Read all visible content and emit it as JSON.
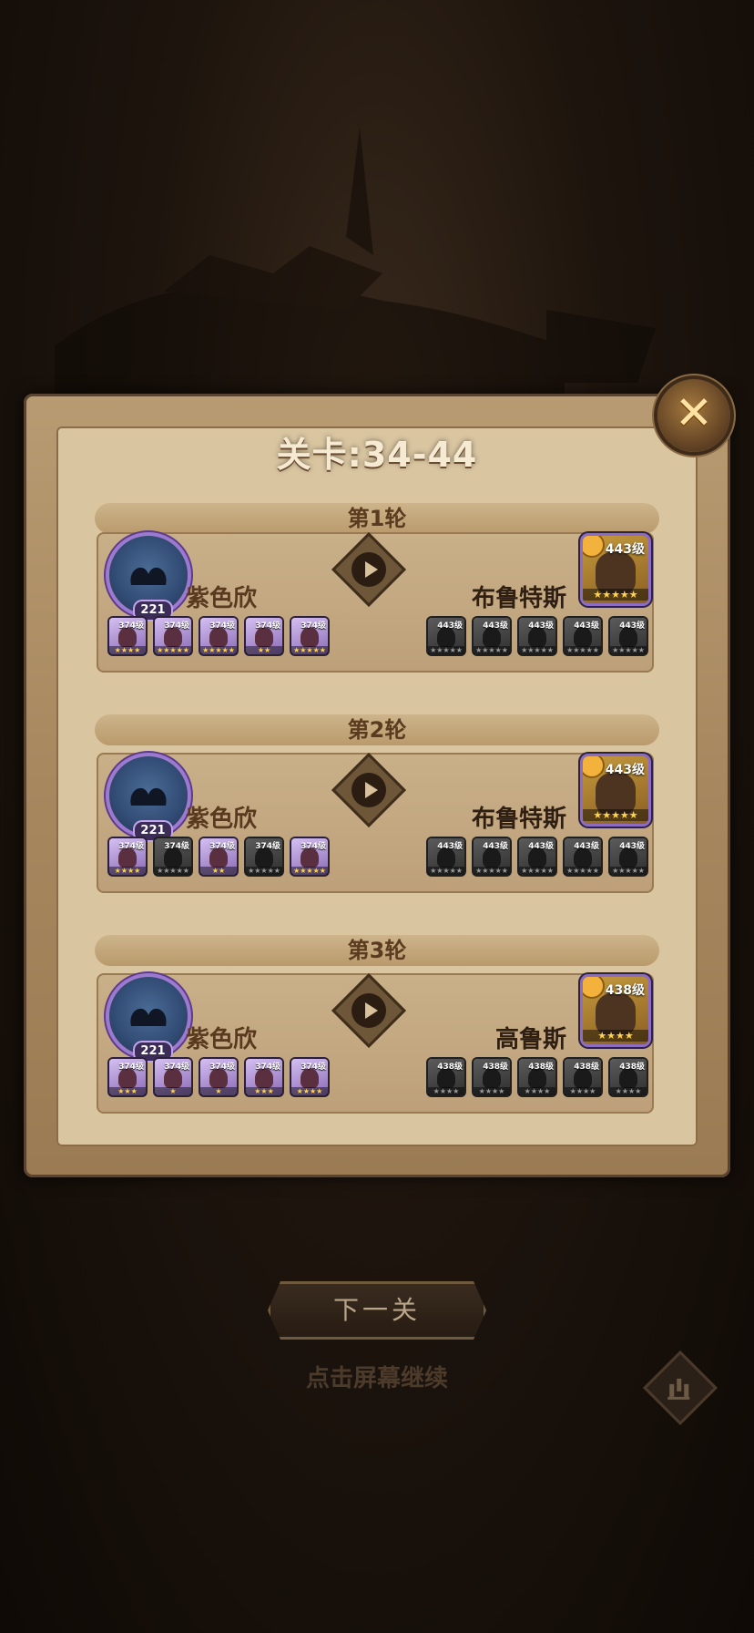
{
  "stage": {
    "title": "关卡:34-44"
  },
  "rounds": [
    {
      "label": "第1轮",
      "player": {
        "name": "紫色欣",
        "level": "221"
      },
      "enemy": {
        "name": "布鲁特斯",
        "level": "443级",
        "stars": "★★★★★"
      },
      "heroes": [
        {
          "level": "374级",
          "stars": "★★★★"
        },
        {
          "level": "374级",
          "stars": "★★★★★"
        },
        {
          "level": "374级",
          "stars": "★★★★★"
        },
        {
          "level": "374级",
          "stars": "★★"
        },
        {
          "level": "374级",
          "stars": "★★★★★"
        }
      ],
      "enemies": [
        {
          "level": "443级",
          "stars": "★★★★★"
        },
        {
          "level": "443级",
          "stars": "★★★★★"
        },
        {
          "level": "443级",
          "stars": "★★★★★"
        },
        {
          "level": "443级",
          "stars": "★★★★★"
        },
        {
          "level": "443级",
          "stars": "★★★★★"
        }
      ]
    },
    {
      "label": "第2轮",
      "player": {
        "name": "紫色欣",
        "level": "221"
      },
      "enemy": {
        "name": "布鲁特斯",
        "level": "443级",
        "stars": "★★★★★"
      },
      "heroes": [
        {
          "level": "374级",
          "stars": "★★★★"
        },
        {
          "level": "374级",
          "stars": "★★★★★"
        },
        {
          "level": "374级",
          "stars": "★★"
        },
        {
          "level": "374级",
          "stars": "★★★★★"
        },
        {
          "level": "374级",
          "stars": "★★★★★"
        }
      ],
      "enemies": [
        {
          "level": "443级",
          "stars": "★★★★★"
        },
        {
          "level": "443级",
          "stars": "★★★★★"
        },
        {
          "level": "443级",
          "stars": "★★★★★"
        },
        {
          "level": "443级",
          "stars": "★★★★★"
        },
        {
          "level": "443级",
          "stars": "★★★★★"
        }
      ]
    },
    {
      "label": "第3轮",
      "player": {
        "name": "紫色欣",
        "level": "221"
      },
      "enemy": {
        "name": "高鲁斯",
        "level": "438级",
        "stars": "★★★★"
      },
      "heroes": [
        {
          "level": "374级",
          "stars": "★★★"
        },
        {
          "level": "374级",
          "stars": "★"
        },
        {
          "level": "374级",
          "stars": "★"
        },
        {
          "level": "374级",
          "stars": "★★★"
        },
        {
          "level": "374级",
          "stars": "★★★★"
        }
      ],
      "enemies": [
        {
          "level": "438级",
          "stars": "★★★★"
        },
        {
          "level": "438级",
          "stars": "★★★★"
        },
        {
          "level": "438级",
          "stars": "★★★★"
        },
        {
          "level": "438级",
          "stars": "★★★★"
        },
        {
          "level": "438级",
          "stars": "★★★★"
        }
      ]
    }
  ],
  "actions": {
    "next_label": "下一关",
    "hint": "点击屏幕继续",
    "close_icon": "close-icon",
    "stats_icon": "stats-icon"
  }
}
